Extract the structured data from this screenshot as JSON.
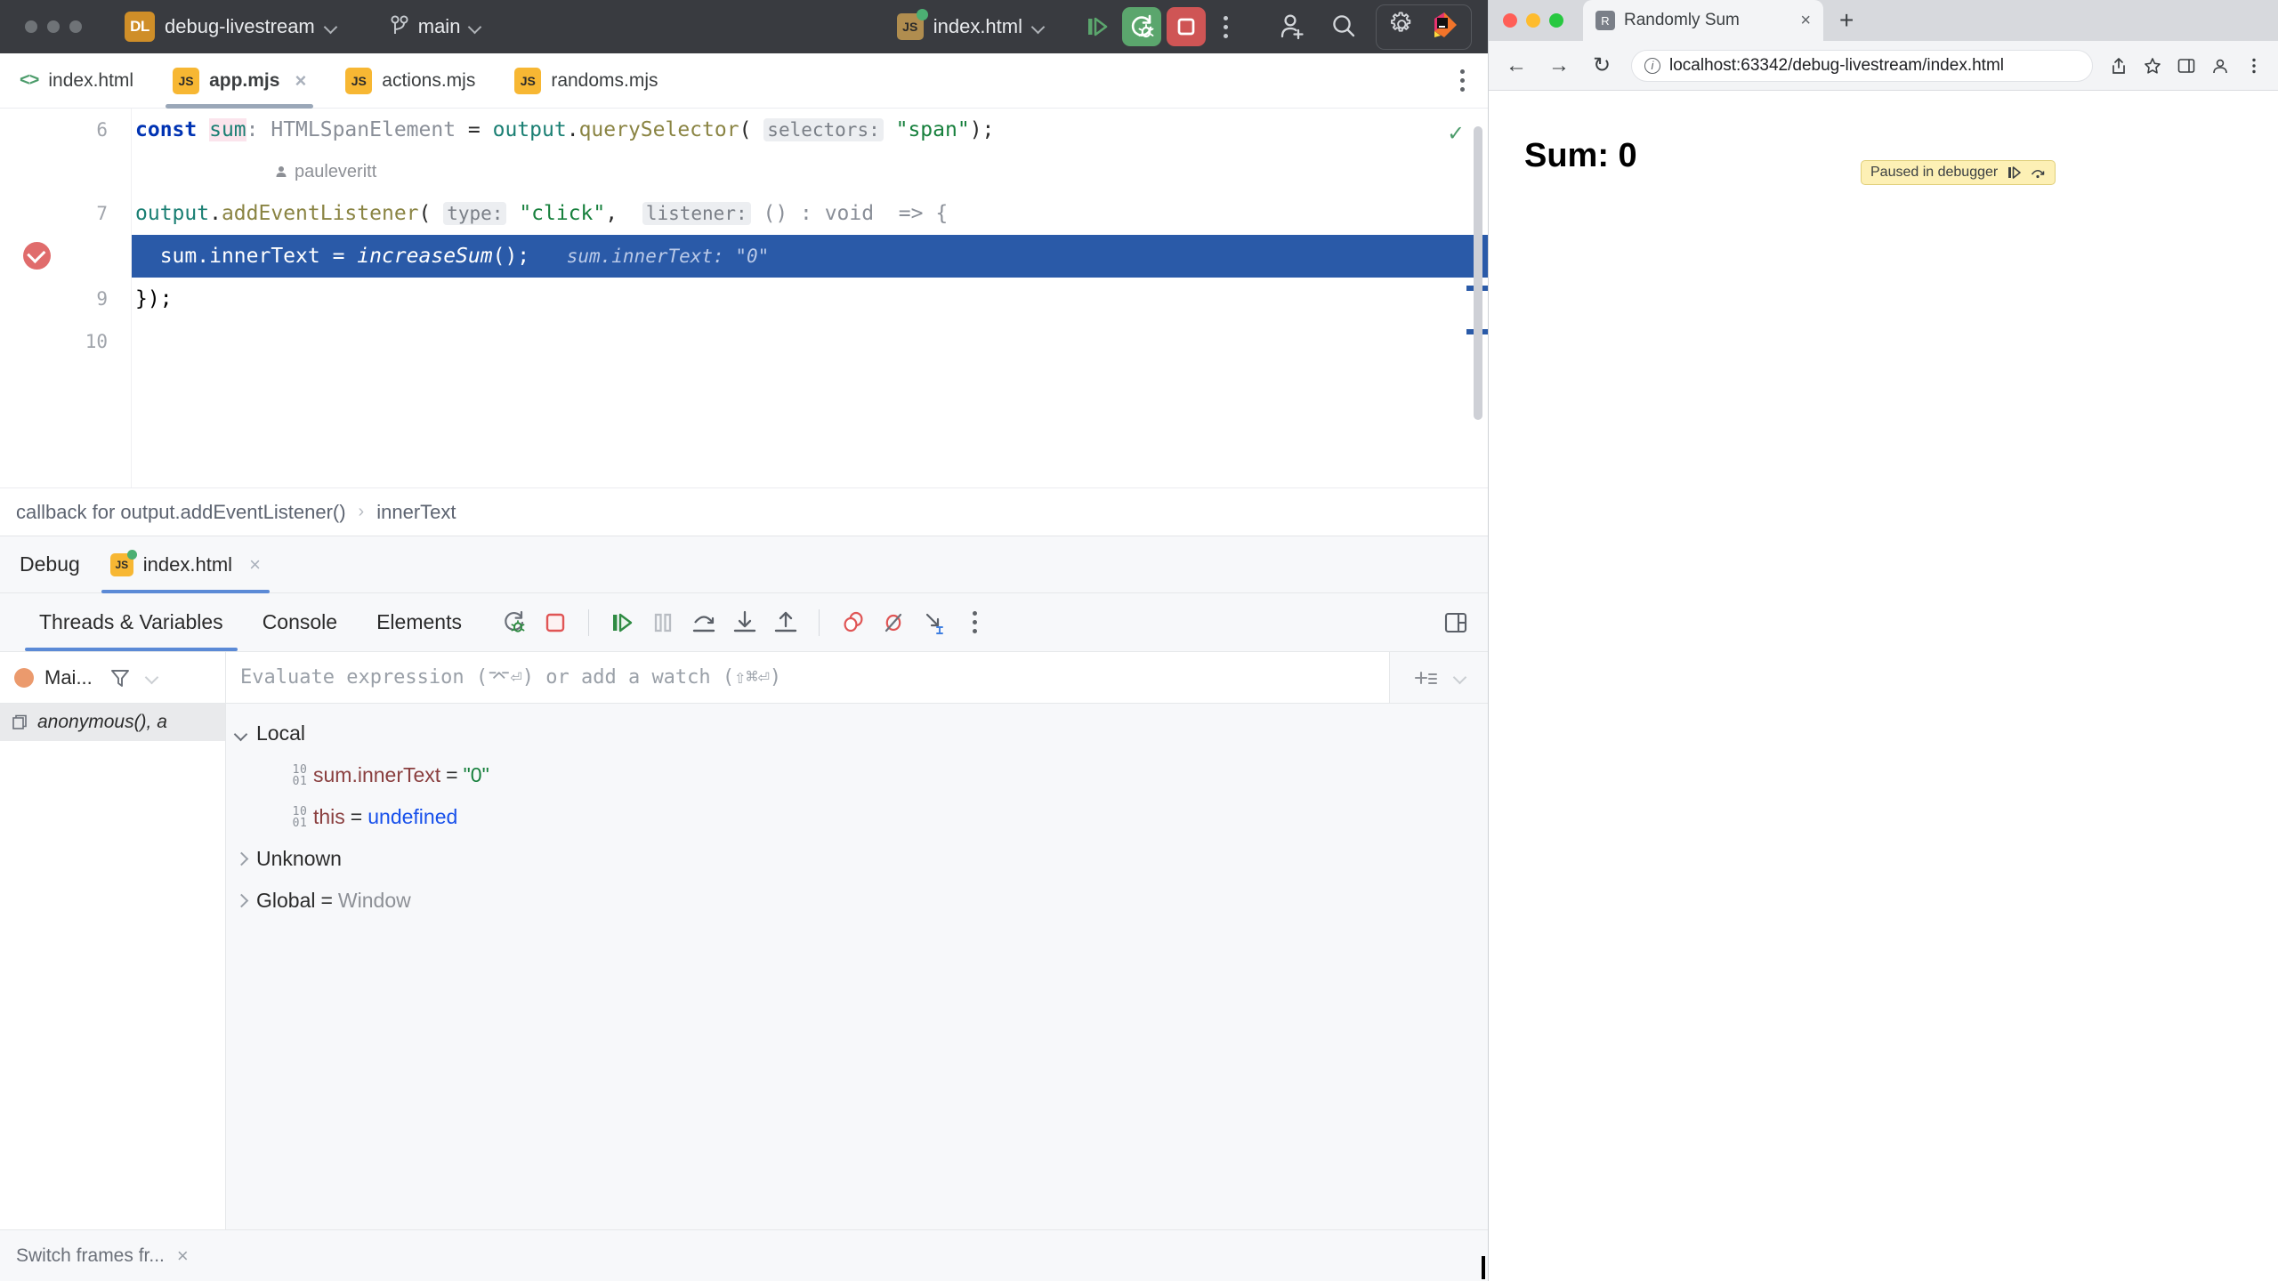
{
  "ide": {
    "toolbar": {
      "project_badge": "DL",
      "project_name": "debug-livestream",
      "branch": "main",
      "run_config": "index.html",
      "icons": {
        "run_debug": "debug-icon",
        "stop": "stop-icon",
        "more": "more-vertical-icon",
        "add_user": "add-user-icon",
        "search": "search-icon",
        "settings": "gear-icon",
        "ai": "jetbrains-ai-icon"
      }
    },
    "editor_tabs": [
      {
        "label": "index.html",
        "icon": "html-icon",
        "active": false,
        "closeable": false
      },
      {
        "label": "app.mjs",
        "icon": "js-icon",
        "active": true,
        "closeable": true
      },
      {
        "label": "actions.mjs",
        "icon": "js-icon",
        "active": false,
        "closeable": false
      },
      {
        "label": "randoms.mjs",
        "icon": "js-icon",
        "active": false,
        "closeable": false
      }
    ],
    "code": {
      "line_numbers": [
        "6",
        "7",
        "",
        "9",
        "10"
      ],
      "annotation_author": "pauleveritt",
      "line6": {
        "kw": "const",
        "var": "sum",
        "type": ": HTMLSpanElement",
        "eq": " = ",
        "obj": "output",
        "dot": ".",
        "fn": "querySelector",
        "open": "(",
        "param_hint": "selectors:",
        "str": "\"span\"",
        "close": ");"
      },
      "line7": {
        "obj": "output",
        "dot": ".",
        "fn": "addEventListener",
        "open": "(",
        "param_hint1": "type:",
        "str": "\"click\"",
        "comma": ", ",
        "param_hint2": "listener:",
        "tail": "() : void  => {"
      },
      "line8": {
        "text": "sum.innerText = ",
        "call": "increaseSum",
        "end": "();",
        "inline_value": "sum.innerText: \"0\""
      },
      "line9": "});"
    },
    "breadcrumb": {
      "first": "callback for output.addEventListener()",
      "separator": "›",
      "second": "innerText"
    },
    "debug": {
      "title": "Debug",
      "session_tab": "index.html",
      "tabs": [
        {
          "label": "Threads & Variables",
          "active": true
        },
        {
          "label": "Console",
          "active": false
        },
        {
          "label": "Elements",
          "active": false
        }
      ],
      "toolbar_icons": [
        "rerun-debug-icon",
        "stop-icon",
        "resume-icon",
        "pause-icon",
        "step-over-icon",
        "step-into-icon",
        "step-out-icon",
        "view-breakpoints-icon",
        "mute-breakpoints-icon",
        "run-to-cursor-icon",
        "more-vertical-icon",
        "layout-settings-icon"
      ],
      "thread_label": "Mai...",
      "filter_icon": "filter-icon",
      "thread_dropdown_icon": "chevron-down-icon",
      "evaluate_placeholder": "Evaluate expression (⌤⏎) or add a watch (⇧⌘⏎)",
      "add_watch_icon": "add-watch-icon",
      "frames": [
        {
          "label": "anonymous(), a",
          "icon": "frame-icon",
          "selected": true
        }
      ],
      "variables": [
        {
          "indent": 0,
          "arrow": "down",
          "icon": "",
          "name": "Local",
          "eq": "",
          "value": "",
          "value_kind": "none"
        },
        {
          "indent": 2,
          "arrow": "none",
          "icon": "binary",
          "name": "sum.innerText",
          "eq": "=",
          "value": "\"0\"",
          "value_kind": "string"
        },
        {
          "indent": 2,
          "arrow": "none",
          "icon": "binary",
          "name": "this",
          "eq": "=",
          "value": "undefined",
          "value_kind": "keyword"
        },
        {
          "indent": 0,
          "arrow": "right",
          "icon": "",
          "name": "Unknown",
          "eq": "",
          "value": "",
          "value_kind": "none"
        },
        {
          "indent": 0,
          "arrow": "right",
          "icon": "",
          "name": "Global",
          "eq": "=",
          "value": "Window",
          "value_kind": "grey"
        }
      ]
    },
    "status_bar": {
      "message": "Switch frames fr...",
      "close": "×"
    }
  },
  "browser": {
    "tab_title": "Randomly Sum",
    "tab_favicon": "R",
    "new_tab_icon": "plus-icon",
    "nav": {
      "back": "←",
      "forward": "→",
      "reload": "↻"
    },
    "address": "localhost:63342/debug-livestream/index.html",
    "toolbar_icons": [
      "share-icon",
      "bookmark-icon",
      "sidepanel-icon",
      "profile-icon",
      "menu-icon"
    ],
    "paused_banner": {
      "text": "Paused in debugger",
      "resume_icon": "resume-icon",
      "step-over_icon": "step-over-icon"
    },
    "page_text": "Sum: 0"
  },
  "colors": {
    "ide_toolbar_bg": "#393b40",
    "accent_blue": "#2a5aa8",
    "debug_green": "#5ba66d",
    "stop_red": "#cf5555",
    "breakpoint_red": "#e06c6c",
    "project_badge": "#cf8e28"
  }
}
